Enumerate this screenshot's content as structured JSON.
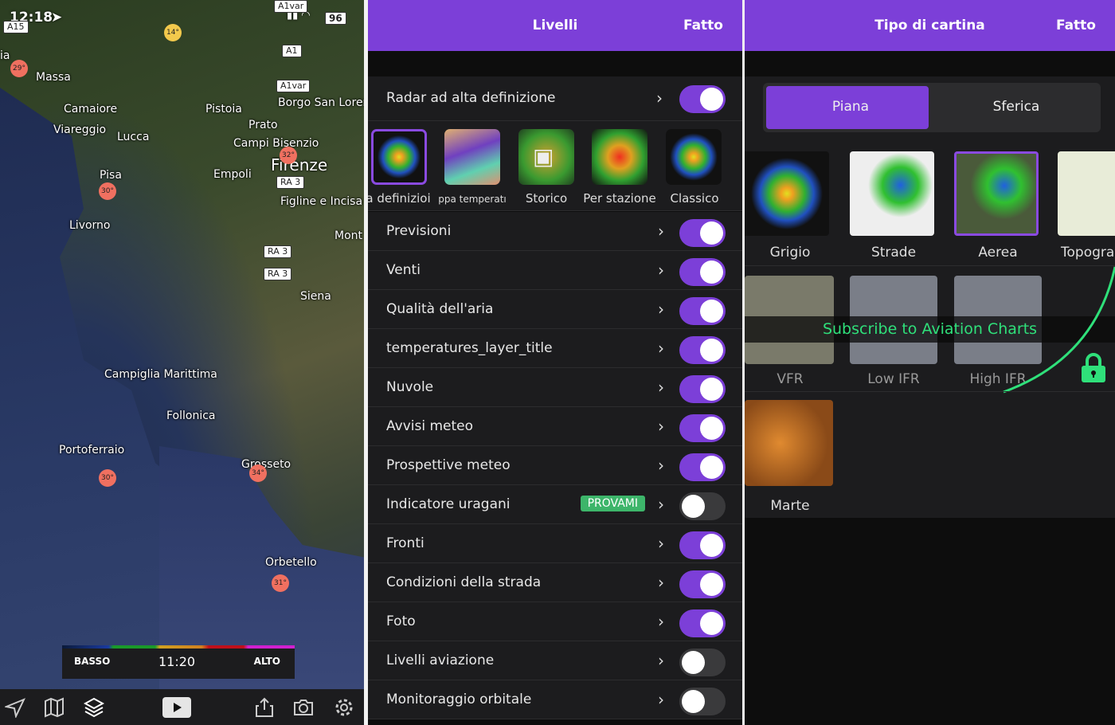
{
  "map": {
    "status": {
      "time": "12:18",
      "battery": "96"
    },
    "labels": [
      "ia",
      "Massa",
      "Camaiore",
      "Viareggio",
      "Lucca",
      "Pistoia",
      "Prato",
      "Campi Bisenzio",
      "Firenze",
      "Borgo San Loren",
      "Empoli",
      "Pisa",
      "Figline e Incisa V",
      "Livorno",
      "Mont",
      "Siena",
      "Campiglia Marittima",
      "Follonica",
      "Portoferraio",
      "Grosseto",
      "Orbetello"
    ],
    "shields": [
      "A15",
      "A1var",
      "A1",
      "A1var",
      "RA 3",
      "RA 3",
      "RA 3"
    ],
    "temps": [
      "14°",
      "29°",
      "32°",
      "30°",
      "30°",
      "34°",
      "31°"
    ],
    "legend": {
      "low": "BASSO",
      "time": "11:20",
      "high": "ALTO"
    }
  },
  "layers": {
    "title": "Livelli",
    "done": "Fatto",
    "radar_row": "Radar ad alta definizione",
    "radar_types": [
      "a definizioi",
      "ppa temperatı",
      "Storico",
      "Per stazione",
      "Classico"
    ],
    "rows": [
      {
        "name": "Previsioni",
        "on": true
      },
      {
        "name": "Venti",
        "on": true
      },
      {
        "name": "Qualità dell'aria",
        "on": true
      },
      {
        "name": "temperatures_layer_title",
        "on": true
      },
      {
        "name": "Nuvole",
        "on": true
      },
      {
        "name": "Avvisi meteo",
        "on": true
      },
      {
        "name": "Prospettive meteo",
        "on": true
      },
      {
        "name": "Indicatore uragani",
        "on": false,
        "badge": "PROVAMI"
      },
      {
        "name": "Fronti",
        "on": true
      },
      {
        "name": "Condizioni della strada",
        "on": true
      },
      {
        "name": "Foto",
        "on": true
      },
      {
        "name": "Livelli aviazione",
        "on": false
      },
      {
        "name": "Monitoraggio orbitale",
        "on": false
      }
    ]
  },
  "maptype": {
    "title": "Tipo di cartina",
    "done": "Fatto",
    "segments": [
      "Piana",
      "Sferica"
    ],
    "types": [
      "Grigio",
      "Strade",
      "Aerea",
      "Topogra"
    ],
    "aviation": [
      "VFR",
      "Low IFR",
      "High IFR"
    ],
    "subscribe": "Subscribe to Aviation Charts",
    "other": [
      "Marte"
    ]
  },
  "colors": {
    "accent": "#7c3fd8",
    "green": "#2fe07a"
  }
}
